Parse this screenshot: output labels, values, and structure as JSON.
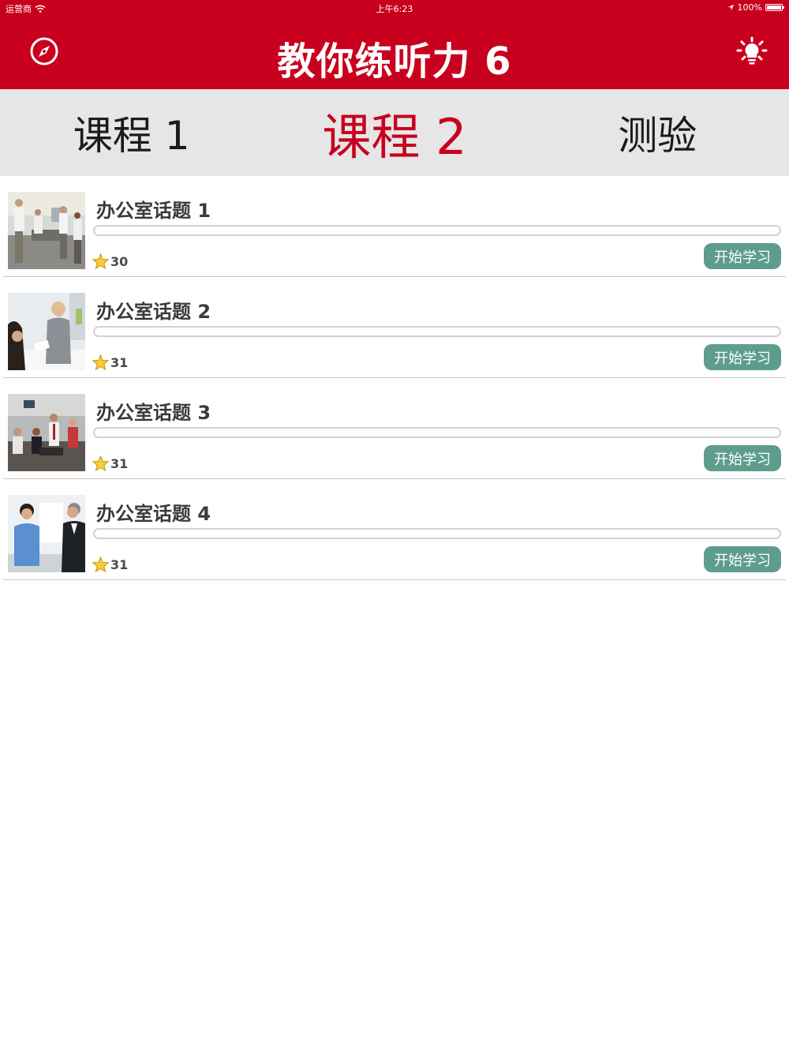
{
  "status_bar": {
    "carrier": "运营商",
    "time": "上午6:23",
    "battery": "100%",
    "battery_level": 1.0
  },
  "header": {
    "title": "教你练听力 6",
    "left_icon": "compass-icon",
    "right_icon": "lightbulb-icon",
    "bg_color": "#c8001e"
  },
  "tabs": [
    {
      "label": "课程 1",
      "active": false
    },
    {
      "label": "课程 2",
      "active": true
    },
    {
      "label": "测验",
      "active": false
    }
  ],
  "lessons": [
    {
      "title": "办公室话题 1",
      "stars": "30",
      "button": "开始学习",
      "progress": 0
    },
    {
      "title": "办公室话题 2",
      "stars": "31",
      "button": "开始学习",
      "progress": 0
    },
    {
      "title": "办公室话题 3",
      "stars": "31",
      "button": "开始学习",
      "progress": 0
    },
    {
      "title": "办公室话题 4",
      "stars": "31",
      "button": "开始学习",
      "progress": 0
    }
  ],
  "colors": {
    "accent": "#c8001e",
    "button": "#5e9c8e",
    "tab_bg": "#e6e6e6"
  }
}
